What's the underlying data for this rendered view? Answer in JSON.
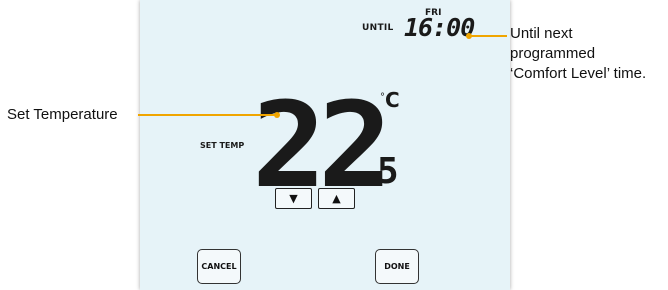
{
  "display": {
    "until_label": "UNTIL",
    "day": "FRI",
    "time": "16:00",
    "set_temp_label": "SET TEMP",
    "temperature_whole": "22",
    "temperature_decimal": "5",
    "unit": "C",
    "degree_symbol": "°"
  },
  "buttons": {
    "down_glyph": "▼",
    "up_glyph": "▲",
    "cancel_label": "CANCEL",
    "done_label": "DONE"
  },
  "annotations": {
    "until_lines": [
      "Until next",
      "programmed",
      "‘Comfort Level’ time."
    ],
    "set_temperature": "Set Temperature"
  },
  "colors": {
    "screen_background": "#e6f3f8",
    "callout_accent": "#f0a500"
  }
}
